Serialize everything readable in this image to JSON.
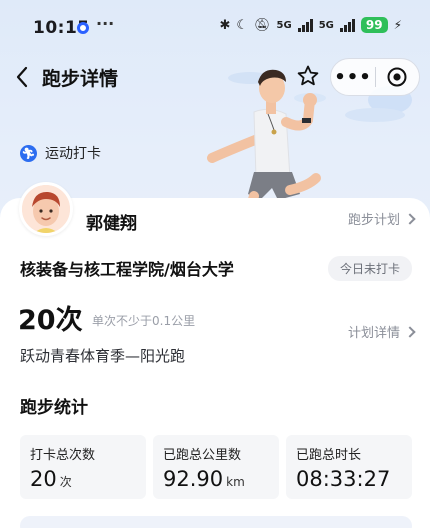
{
  "status_bar": {
    "time": "10:15",
    "dots": "···",
    "signal1": "5G",
    "signal2": "5G",
    "battery": "99"
  },
  "header": {
    "title": "跑步详情"
  },
  "badge": {
    "label": "运动打卡"
  },
  "user": {
    "name": "郭健翔",
    "plan_link": "跑步计划",
    "school": "核装备与核工程学院/烟台大学",
    "status": "今日未打卡"
  },
  "summary": {
    "count": "20次",
    "note": "单次不少于0.1公里",
    "detail_link": "计划详情",
    "season": "跃动青春体育季—阳光跑"
  },
  "stats": {
    "title": "跑步统计",
    "items": [
      {
        "label": "打卡总次数",
        "value": "20",
        "unit": "次"
      },
      {
        "label": "已跑总公里数",
        "value": "92.90",
        "unit": "km"
      },
      {
        "label": "已跑总时长",
        "value": "08:33:27",
        "unit": ""
      }
    ]
  },
  "colors": {
    "accent": "#2c6df0",
    "battery": "#2fbf5a"
  }
}
